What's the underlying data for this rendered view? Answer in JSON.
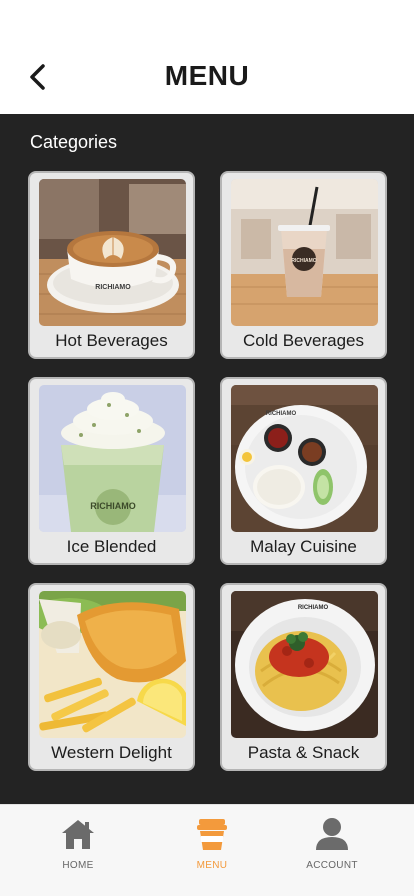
{
  "header": {
    "title": "MENU"
  },
  "section_label": "Categories",
  "categories": [
    {
      "label": "Hot Beverages"
    },
    {
      "label": "Cold Beverages"
    },
    {
      "label": "Ice Blended"
    },
    {
      "label": "Malay Cuisine"
    },
    {
      "label": "Western Delight"
    },
    {
      "label": "Pasta & Snack"
    }
  ],
  "bottom_nav": {
    "home_label": "HOME",
    "menu_label": "MENU",
    "account_label": "ACCOUNT",
    "active": "MENU"
  },
  "brand_text": "RICHIAMO",
  "colors": {
    "accent": "#f39a3c",
    "panel_background": "#232323",
    "card_background": "#e8e8e8",
    "nav_icon": "#6b6b6b"
  }
}
